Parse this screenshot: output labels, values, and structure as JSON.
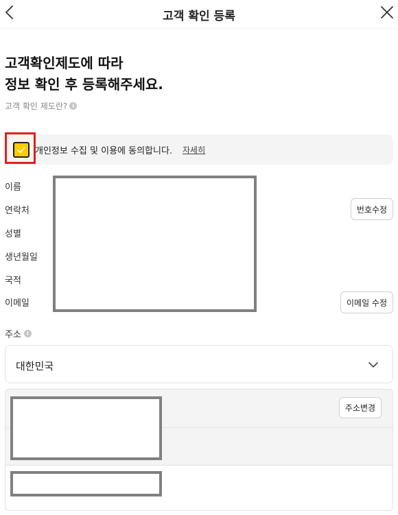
{
  "header": {
    "title": "고객 확인 등록"
  },
  "intro": {
    "line1": "고객확인제도에 따라",
    "line2": "정보 확인 후 등록해주세요.",
    "help_link": "고객 확인 제도란?"
  },
  "consent": {
    "checked": true,
    "text": "개인정보 수집 및 이용에 동의합니다.",
    "detail_link": "자세히",
    "checkbox_color": "#ffcc00",
    "highlight_color": "#e0201e"
  },
  "fields": {
    "name_label": "이름",
    "phone_label": "연락처",
    "gender_label": "성별",
    "birthdate_label": "생년월일",
    "nationality_label": "국적",
    "email_label": "이메일"
  },
  "buttons": {
    "edit_phone": "번호수정",
    "edit_email": "이메일 수정",
    "change_address": "주소변경"
  },
  "address": {
    "label": "주소",
    "country": "대한민국"
  }
}
